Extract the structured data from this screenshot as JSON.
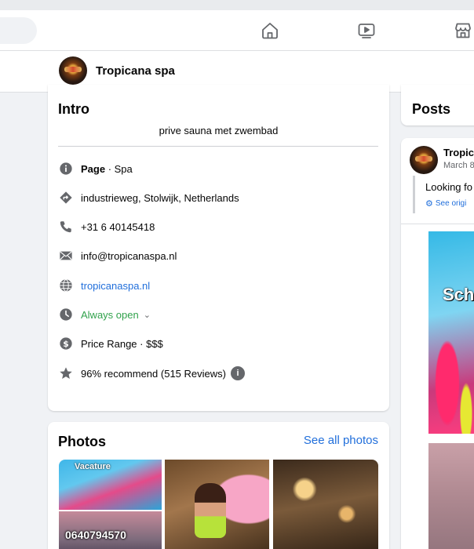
{
  "page": {
    "name": "Tropicana spa"
  },
  "nav": {
    "icons": [
      "home-icon",
      "video-icon",
      "marketplace-icon"
    ]
  },
  "intro": {
    "title": "Intro",
    "bio": "prive sauna met zwembad",
    "category_prefix": "Page",
    "category_suffix": " · Spa",
    "address": "industrieweg, Stolwijk, Netherlands",
    "phone": "+31 6 40145418",
    "email": "info@tropicanaspa.nl",
    "website": "tropicanaspa.nl",
    "hours": "Always open",
    "price_range": "Price Range · $$$",
    "recommend": "96% recommend (515 Reviews)",
    "info_badge": "i",
    "hours_chevron": "⌄"
  },
  "photos": {
    "title": "Photos",
    "see_all": "See all photos",
    "items": [
      {
        "label": "Vacature"
      },
      {
        "label": "0640794570"
      },
      {
        "label": ""
      },
      {
        "label": ""
      }
    ]
  },
  "posts": {
    "title": "Posts",
    "author": "Tropica",
    "date": "March 8",
    "text": "Looking fo",
    "translate": "See origi",
    "image_label": "Sch"
  },
  "colors": {
    "link": "#216fdb",
    "open_green": "#31a24c",
    "icon_gray": "#65676b",
    "background": "#f0f2f5"
  }
}
